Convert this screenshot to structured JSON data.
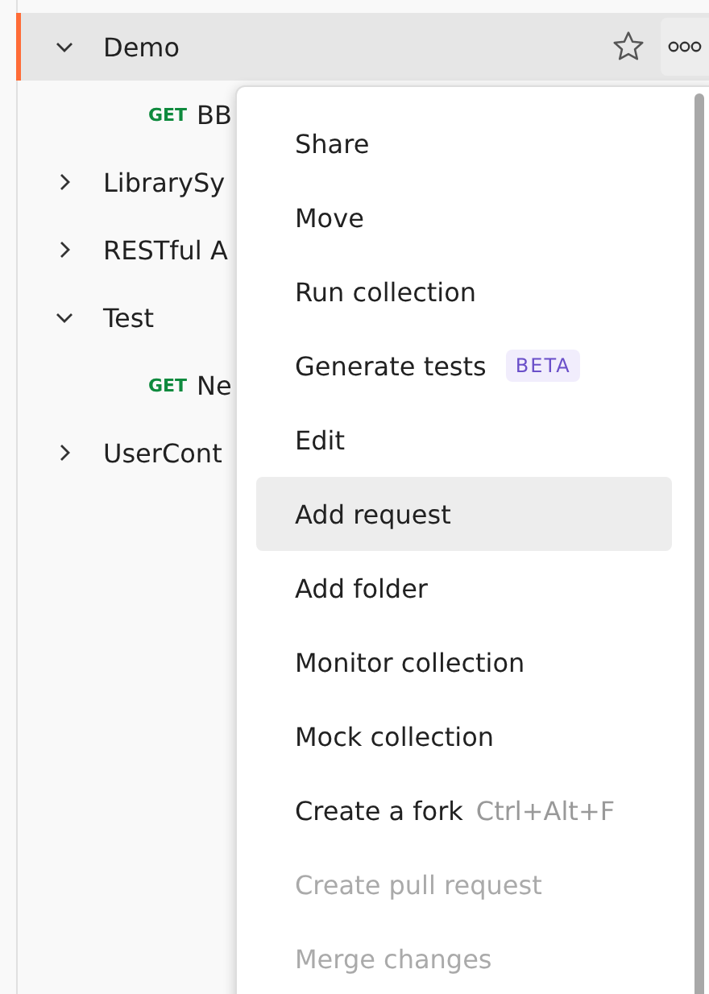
{
  "tree": [
    {
      "name": "Demo",
      "expanded": true,
      "selected": true,
      "children": [
        {
          "method": "GET",
          "name": "BB"
        }
      ]
    },
    {
      "name": "LibrarySy",
      "expanded": false,
      "selected": false
    },
    {
      "name": "RESTful A",
      "expanded": false,
      "selected": false
    },
    {
      "name": "Test",
      "expanded": true,
      "selected": false,
      "children": [
        {
          "method": "GET",
          "name": "Ne"
        }
      ]
    },
    {
      "name": "UserCont",
      "expanded": false,
      "selected": false
    }
  ],
  "menu": [
    {
      "label": "Share",
      "disabled": false,
      "selected": false
    },
    {
      "label": "Move",
      "disabled": false,
      "selected": false
    },
    {
      "label": "Run collection",
      "disabled": false,
      "selected": false
    },
    {
      "label": "Generate tests",
      "badge": "BETA",
      "disabled": false,
      "selected": false
    },
    {
      "label": "Edit",
      "disabled": false,
      "selected": false
    },
    {
      "label": "Add request",
      "disabled": false,
      "selected": true
    },
    {
      "label": "Add folder",
      "disabled": false,
      "selected": false
    },
    {
      "label": "Monitor collection",
      "disabled": false,
      "selected": false
    },
    {
      "label": "Mock collection",
      "disabled": false,
      "selected": false
    },
    {
      "label": "Create a fork",
      "shortcut": "Ctrl+Alt+F",
      "disabled": false,
      "selected": false
    },
    {
      "label": "Create pull request",
      "disabled": true,
      "selected": false
    },
    {
      "label": "Merge changes",
      "disabled": true,
      "selected": false
    }
  ]
}
